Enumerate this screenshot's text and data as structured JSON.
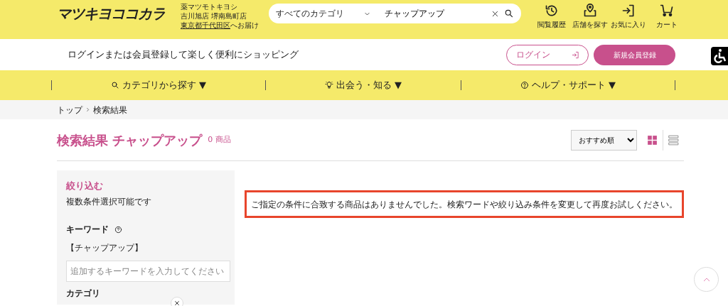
{
  "header": {
    "logo": "マツキヨココカラ",
    "store_lines": [
      "薬マツモトキヨシ",
      "吉川旭店 堺南島町店"
    ],
    "delivery_area": "東京都千代田区",
    "delivery_suffix": "へお届け",
    "search": {
      "category": "すべてのカテゴリ",
      "query": "チャップアップ"
    },
    "icons": [
      {
        "kind": "history",
        "label": "閲覧履歴"
      },
      {
        "kind": "store",
        "label": "店舗を探す"
      },
      {
        "kind": "favorite",
        "label": "お気に入り"
      },
      {
        "kind": "cart",
        "label": "カート"
      }
    ]
  },
  "login_bar": {
    "message": "ログインまたは会員登録して楽しく便利にショッピング",
    "login": "ログイン",
    "register": "新規会員登録"
  },
  "nav": [
    {
      "kind": "search",
      "label": "カテゴリから探す"
    },
    {
      "kind": "bulb",
      "label": "出会う・知る"
    },
    {
      "kind": "help",
      "label": "ヘルプ・サポート"
    }
  ],
  "nav_caret": "▼",
  "breadcrumb": [
    "トップ",
    "検索結果"
  ],
  "results": {
    "title": "検索結果",
    "query": "チャップアップ",
    "count": "0 商品",
    "sort": "おすすめ順",
    "view_modes": [
      {
        "kind": "grid",
        "selected": true
      },
      {
        "kind": "list",
        "selected": false
      }
    ],
    "message": "ご指定の条件に合致する商品はありませんでした。検索ワードや絞り込み条件を変更して再度お試しください。"
  },
  "sidebar": {
    "title": "絞り込む",
    "note": "複数条件選択可能です",
    "keyword_heading": "キーワード",
    "keyword": "【チャップアップ】",
    "keyword_placeholder": "追加するキーワードを入力してください",
    "next_heading": "カテゴリ"
  }
}
